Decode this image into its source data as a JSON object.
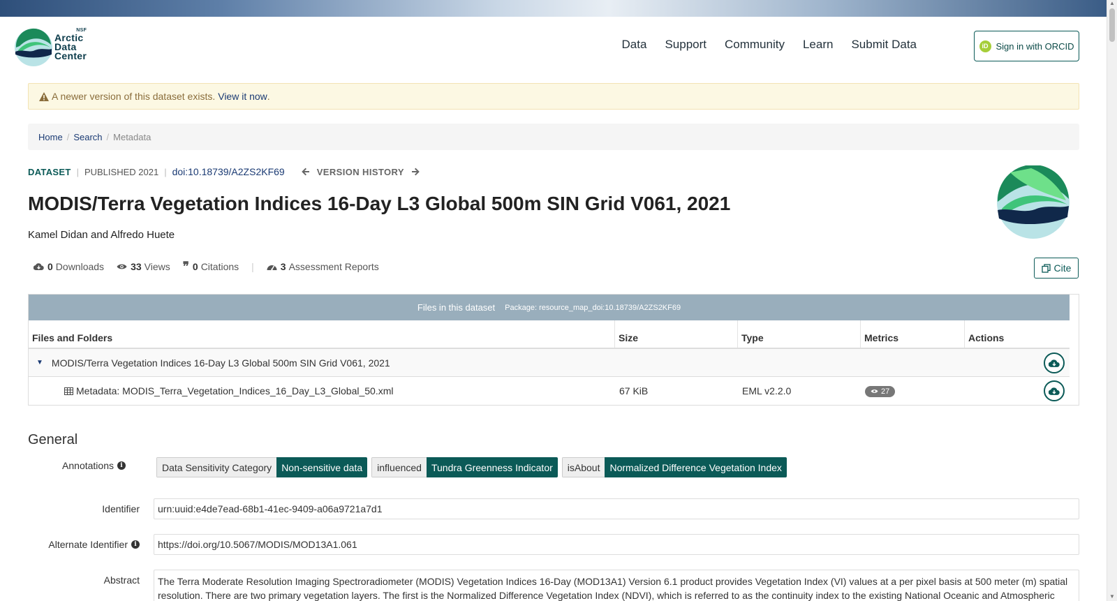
{
  "header": {
    "logo": {
      "line1": "Arctic",
      "line2": "Data",
      "line3": "Center",
      "nsf": "NSF"
    },
    "nav": [
      "Data",
      "Support",
      "Community",
      "Learn",
      "Submit Data"
    ],
    "orcid_label": "Sign in with ORCID",
    "orcid_glyph": "iD"
  },
  "alert": {
    "text": "A newer version of this dataset exists.",
    "link": "View it now",
    "end": "."
  },
  "breadcrumb": {
    "home": "Home",
    "search": "Search",
    "current": "Metadata"
  },
  "dataset": {
    "label": "DATASET",
    "published": "PUBLISHED 2021",
    "doi": "doi:10.18739/A2ZS2KF69",
    "version_history": "VERSION HISTORY",
    "title": "MODIS/Terra Vegetation Indices 16-Day L3 Global 500m SIN Grid V061, 2021",
    "authors": "Kamel Didan and Alfredo Huete"
  },
  "metrics": {
    "downloads_count": "0",
    "downloads_label": "Downloads",
    "views_count": "33",
    "views_label": "Views",
    "citations_count": "0",
    "citations_label": "Citations",
    "assessment_count": "3",
    "assessment_label": "Assessment Reports"
  },
  "cite_label": "Cite",
  "files": {
    "title": "Files in this dataset",
    "package": "Package: resource_map_doi:10.18739/A2ZS2KF69",
    "columns": [
      "Files and Folders",
      "Size",
      "Type",
      "Metrics",
      "Actions"
    ],
    "folder_name": "MODIS/Terra Vegetation Indices 16-Day L3 Global 500m SIN Grid V061, 2021",
    "file": {
      "name": "Metadata: MODIS_Terra_Vegetation_Indices_16_Day_L3_Global_50.xml",
      "size": "67 KiB",
      "type": "EML v2.2.0",
      "views": "27"
    }
  },
  "general": {
    "title": "General",
    "annotations_label": "Annotations",
    "annotations": [
      {
        "property": "Data Sensitivity Category",
        "value": "Non-sensitive data"
      },
      {
        "property": "influenced",
        "value": "Tundra Greenness Indicator"
      },
      {
        "property": "isAbout",
        "value": "Normalized Difference Vegetation Index"
      }
    ],
    "identifier_label": "Identifier",
    "identifier": "urn:uuid:e4de7ead-68b1-41ec-9409-a06a9721a7d1",
    "alternate_label": "Alternate Identifier",
    "alternate": "https://doi.org/10.5067/MODIS/MOD13A1.061",
    "abstract_label": "Abstract",
    "abstract": "The Terra Moderate Resolution Imaging Spectroradiometer (MODIS) Vegetation Indices 16-Day (MOD13A1) Version 6.1 product provides Vegetation Index (VI) values at a per pixel basis at 500 meter (m) spatial resolution. There are two primary vegetation layers. The first is the Normalized Difference Vegetation Index (NDVI), which is referred to as the continuity index to the existing National Oceanic and Atmospheric"
  },
  "colors": {
    "accent": "#0b5a57",
    "link": "#1a3a73",
    "files_header": "#99aebc",
    "alert_bg": "#fcf8e3"
  },
  "icons": [
    "warning-icon",
    "arrow-left-icon",
    "arrow-right-icon",
    "cloud-download-icon",
    "eye-icon",
    "quote-icon",
    "dashboard-icon",
    "copy-icon",
    "caret-down-icon",
    "table-icon",
    "info-icon"
  ]
}
